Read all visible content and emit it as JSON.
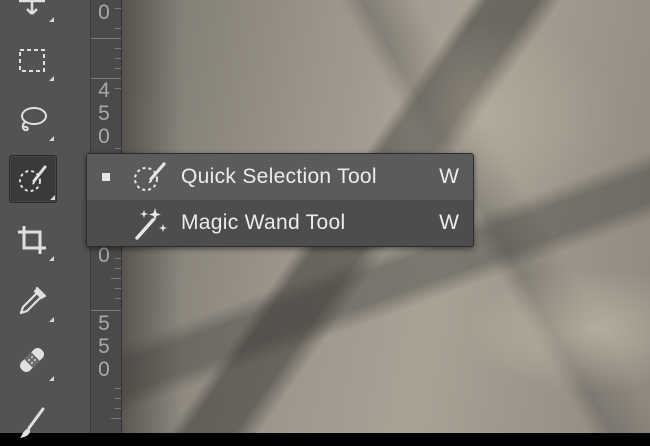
{
  "ruler": {
    "digits": [
      "0",
      "4",
      "5",
      "0",
      "0",
      "5",
      "5",
      "0"
    ]
  },
  "flyout": {
    "items": [
      {
        "label": "Quick Selection Tool",
        "shortcut": "W",
        "selected": true
      },
      {
        "label": "Magic Wand Tool",
        "shortcut": "W",
        "selected": false
      }
    ]
  },
  "toolbar": {
    "tools": [
      "move-tool",
      "rectangular-marquee-tool",
      "lasso-tool",
      "quick-selection-tool",
      "crop-tool",
      "eyedropper-tool",
      "healing-brush-tool",
      "brush-tool"
    ],
    "active_tool": "quick-selection-tool"
  },
  "colors": {
    "toolbar_bg": "#535353",
    "menu_bg": "#4d4d4d",
    "menu_selected_bg": "#5b5b5b",
    "text": "#ececec"
  }
}
